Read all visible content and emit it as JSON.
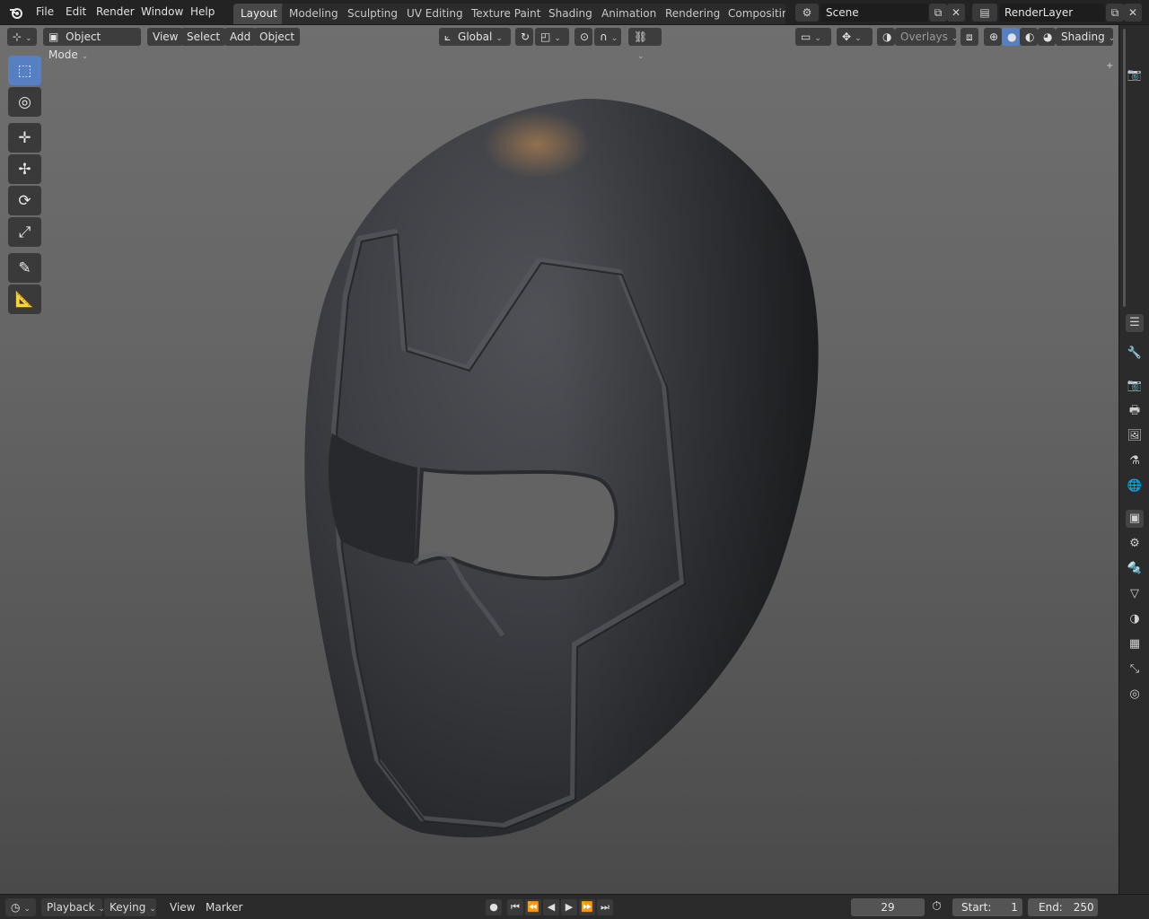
{
  "menus": [
    "File",
    "Edit",
    "Render",
    "Window",
    "Help"
  ],
  "workspaces": [
    "Layout",
    "Modeling",
    "Sculpting",
    "UV Editing",
    "Texture Paint",
    "Shading",
    "Animation",
    "Rendering",
    "Compositing"
  ],
  "active_workspace": "Layout",
  "scene": {
    "name": "Scene"
  },
  "view_layer": {
    "name": "RenderLayer"
  },
  "viewport_header": {
    "mode": "Object Mode",
    "view": "View",
    "select": "Select",
    "add": "Add",
    "object": "Object",
    "orientation": "Global",
    "overlays": "Overlays",
    "shading": "Shading"
  },
  "tools": [
    "select-box",
    "cursor",
    "move",
    "transform",
    "rotate",
    "scale",
    "annotate",
    "measure"
  ],
  "properties_tabs": [
    "tool",
    "render",
    "output",
    "view-layer",
    "scene",
    "world",
    "object",
    "modifiers",
    "particles",
    "physics",
    "constraints",
    "data",
    "material",
    "texture"
  ],
  "timeline": {
    "playback": "Playback",
    "keying": "Keying",
    "view": "View",
    "marker": "Marker",
    "current_frame": "29",
    "start_label": "Start:",
    "start": "1",
    "end_label": "End:",
    "end": "250"
  },
  "colors": {
    "accent": "#5680c2",
    "active_tab": "#484848"
  }
}
